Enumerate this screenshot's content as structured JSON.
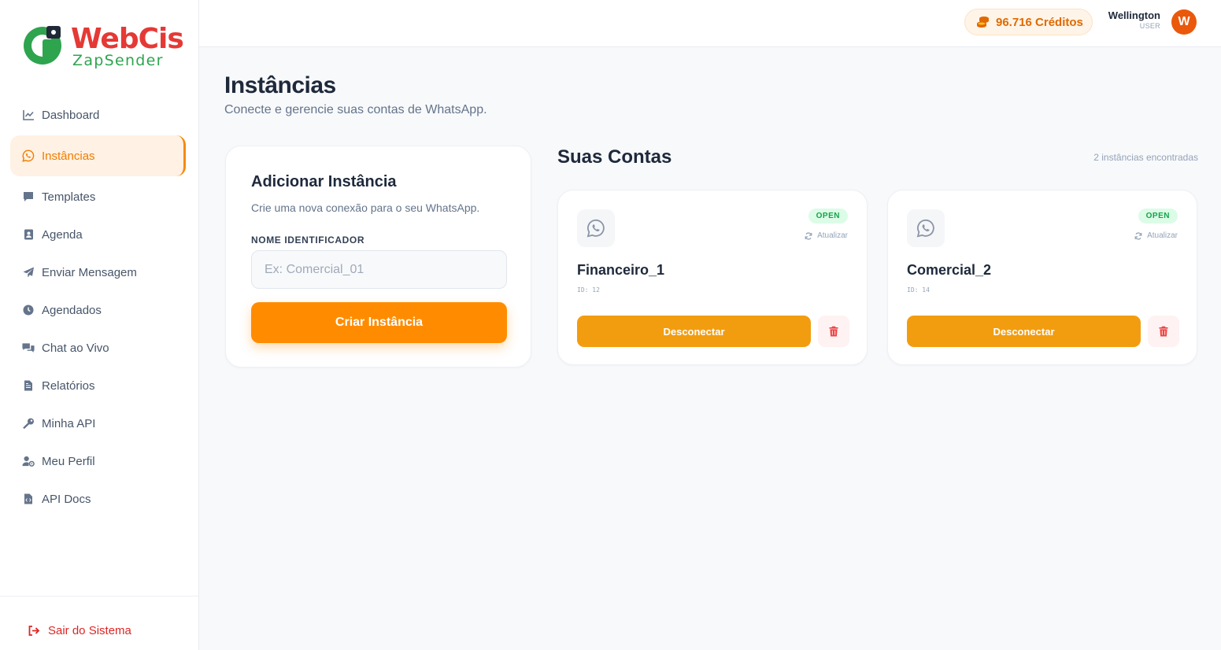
{
  "brand": {
    "name": "WebCis",
    "subtitle": "ZapSender",
    "colors": {
      "red": "#e53935",
      "green": "#2ea44f",
      "accent": "#ff8c00"
    }
  },
  "sidebar": {
    "items": [
      {
        "label": "Dashboard",
        "icon": "chart-line-icon",
        "active": false
      },
      {
        "label": "Instâncias",
        "icon": "whatsapp-icon",
        "active": true
      },
      {
        "label": "Templates",
        "icon": "comment-icon",
        "active": false
      },
      {
        "label": "Agenda",
        "icon": "address-book-icon",
        "active": false
      },
      {
        "label": "Enviar Mensagem",
        "icon": "paper-plane-icon",
        "active": false
      },
      {
        "label": "Agendados",
        "icon": "clock-icon",
        "active": false
      },
      {
        "label": "Chat ao Vivo",
        "icon": "comments-icon",
        "active": false
      },
      {
        "label": "Relatórios",
        "icon": "file-icon",
        "active": false
      },
      {
        "label": "Minha API",
        "icon": "key-icon",
        "active": false
      },
      {
        "label": "Meu Perfil",
        "icon": "user-gear-icon",
        "active": false
      },
      {
        "label": "API Docs",
        "icon": "file-code-icon",
        "active": false
      }
    ],
    "logout_label": "Sair do Sistema"
  },
  "topbar": {
    "credits": "96.716 Créditos",
    "user_name": "Wellington",
    "user_role": "USER",
    "avatar_initial": "W"
  },
  "page": {
    "title": "Instâncias",
    "subtitle": "Conecte e gerencie suas contas de WhatsApp."
  },
  "add_instance": {
    "title": "Adicionar Instância",
    "subtitle": "Crie uma nova conexão para o seu WhatsApp.",
    "field_label": "NOME IDENTIFICADOR",
    "placeholder": "Ex: Comercial_01",
    "value": "",
    "button_label": "Criar Instância"
  },
  "accounts": {
    "title": "Suas Contas",
    "count_label": "2 instâncias encontradas",
    "items": [
      {
        "name": "Financeiro_1",
        "id_label": "ID: 12",
        "status": "OPEN",
        "refresh_label": "Atualizar",
        "disconnect_label": "Desconectar"
      },
      {
        "name": "Comercial_2",
        "id_label": "ID: 14",
        "status": "OPEN",
        "refresh_label": "Atualizar",
        "disconnect_label": "Desconectar"
      }
    ]
  }
}
